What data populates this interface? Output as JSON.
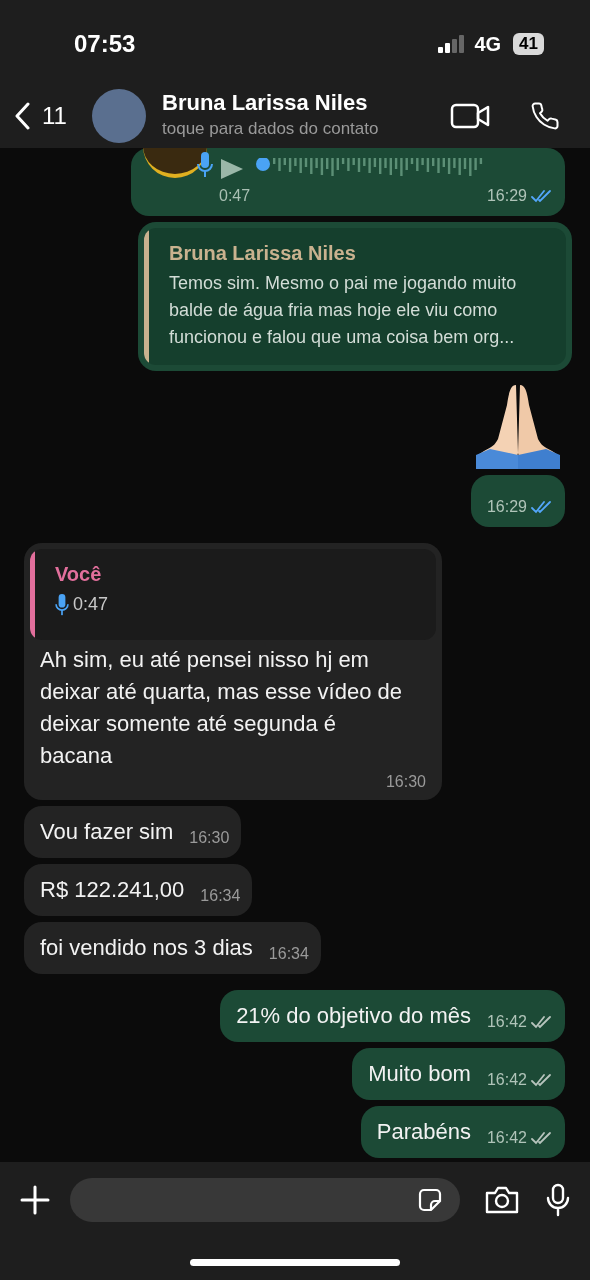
{
  "status_bar": {
    "time": "07:53",
    "network": "4G",
    "battery": "41"
  },
  "header": {
    "back_count": "11",
    "name": "Bruna Larissa  Niles",
    "subtitle": "toque para dados do contato"
  },
  "messages": [
    {
      "kind": "voice",
      "outgoing": true,
      "duration": "0:47",
      "time": "16:29",
      "read": true
    },
    {
      "kind": "reply",
      "outgoing": true,
      "quote_author": "Bruna Larissa  Niles",
      "quote_text": "Temos sim. Mesmo o pai me jogando muito balde de água fria mas hoje ele viu como funcionou e falou que uma coisa bem org...",
      "color": "#c9b28f"
    },
    {
      "kind": "emoji",
      "outgoing": true
    },
    {
      "kind": "text",
      "outgoing": true,
      "time": "16:29",
      "read": true
    },
    {
      "kind": "reply",
      "outgoing": false,
      "quote_author": "Você",
      "quote_voice": "0:47",
      "color": "#e26f9c",
      "text": "Ah sim, eu até pensei nisso hj em deixar até quarta, mas esse vídeo de deixar somente até segunda é bacana",
      "time": "16:30"
    },
    {
      "kind": "text",
      "outgoing": false,
      "text": "Vou fazer sim",
      "time": "16:30"
    },
    {
      "kind": "text",
      "outgoing": false,
      "text": "R$ 122.241,00",
      "time": "16:34"
    },
    {
      "kind": "text",
      "outgoing": false,
      "text": "foi vendido nos 3 dias",
      "time": "16:34"
    },
    {
      "kind": "text",
      "outgoing": true,
      "text": "21% do objetivo do mês",
      "time": "16:42",
      "read": false
    },
    {
      "kind": "text",
      "outgoing": true,
      "text": "Muito bom",
      "time": "16:42",
      "read": false
    },
    {
      "kind": "text",
      "outgoing": true,
      "text": "Parabéns",
      "time": "16:42",
      "read": false
    }
  ]
}
